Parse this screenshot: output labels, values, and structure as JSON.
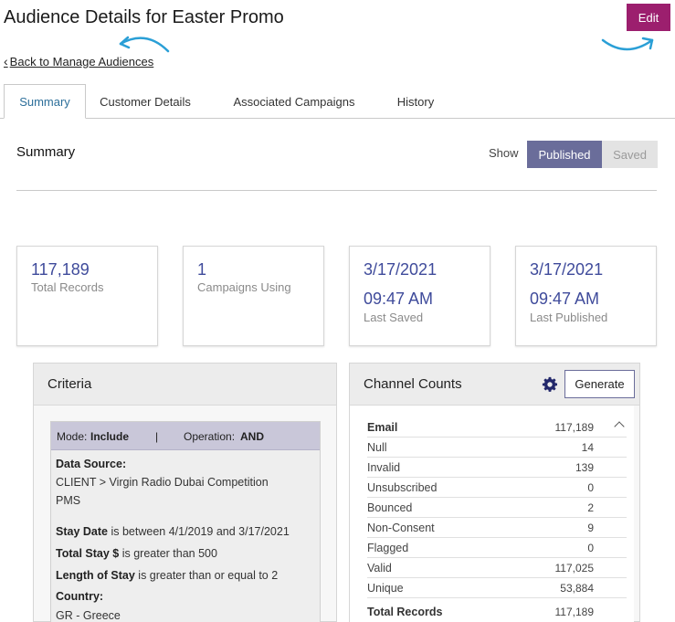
{
  "header": {
    "title": "Audience Details for Easter Promo",
    "edit_label": "Edit",
    "back_label": "Back to Manage Audiences",
    "brand_color": "#9c1f6e"
  },
  "tabs": [
    {
      "label": "Summary",
      "active": true
    },
    {
      "label": "Customer Details",
      "active": false
    },
    {
      "label": "Associated Campaigns",
      "active": false
    },
    {
      "label": "History",
      "active": false
    }
  ],
  "summary": {
    "heading": "Summary",
    "show_label": "Show",
    "toggle": {
      "published": "Published",
      "saved": "Saved",
      "selected": "Published"
    }
  },
  "stats": [
    {
      "value": "117,189",
      "label": "Total Records"
    },
    {
      "value": "1",
      "label": "Campaigns Using"
    },
    {
      "date": "3/17/2021",
      "time": "09:47 AM",
      "label": "Last Saved"
    },
    {
      "date": "3/17/2021",
      "time": "09:47 AM",
      "label": "Last Published"
    }
  ],
  "criteria": {
    "title": "Criteria",
    "mode_label": "Mode:",
    "mode_value": "Include",
    "separator": "|",
    "operation_label": "Operation:",
    "operation_value": "AND",
    "data_source_label": "Data Source:",
    "data_source_line1": "CLIENT > Virgin Radio Dubai Competition",
    "data_source_line2": "PMS",
    "stay_date_label": "Stay Date",
    "stay_date_text": "is between 4/1/2019 and 3/17/2021",
    "total_stay_label": "Total Stay $",
    "total_stay_text": "is greater than 500",
    "length_label": "Length of Stay",
    "length_text": "is greater than or equal to 2",
    "country_label": "Country:",
    "country_value": "GR - Greece"
  },
  "channel_counts": {
    "title": "Channel Counts",
    "generate_label": "Generate",
    "rows": [
      {
        "label": "Email",
        "value": "117,189"
      },
      {
        "label": "Null",
        "value": "14"
      },
      {
        "label": "Invalid",
        "value": "139"
      },
      {
        "label": "Unsubscribed",
        "value": "0"
      },
      {
        "label": "Bounced",
        "value": "2"
      },
      {
        "label": "Non-Consent",
        "value": "9"
      },
      {
        "label": "Flagged",
        "value": "0"
      },
      {
        "label": "Valid",
        "value": "117,025"
      },
      {
        "label": "Unique",
        "value": "53,884"
      },
      {
        "label": "Total Records",
        "value": "117,189"
      }
    ]
  }
}
